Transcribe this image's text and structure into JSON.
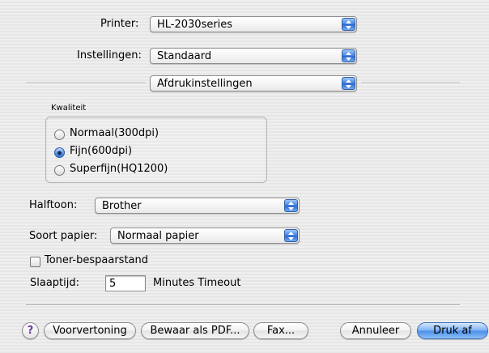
{
  "printer": {
    "label": "Printer:",
    "value": "HL-2030series"
  },
  "settings": {
    "label": "Instellingen:",
    "value": "Standaard"
  },
  "panel_popup": {
    "value": "Afdrukinstellingen"
  },
  "quality": {
    "title": "Kwaliteit",
    "options": [
      {
        "label": "Normaal(300dpi)",
        "selected": false
      },
      {
        "label": "Fijn(600dpi)",
        "selected": true
      },
      {
        "label": "Superfijn(HQ1200)",
        "selected": false
      }
    ]
  },
  "halftone": {
    "label": "Halftoon:",
    "value": "Brother"
  },
  "paper_type": {
    "label": "Soort papier:",
    "value": "Normaal papier"
  },
  "toner_save": {
    "label": "Toner-bespaarstand",
    "checked": false
  },
  "sleep": {
    "label": "Slaaptijd:",
    "value": "5",
    "unit": "Minutes Timeout"
  },
  "buttons": {
    "help": "?",
    "preview": "Voorvertoning",
    "save_pdf": "Bewaar als PDF...",
    "fax": "Fax...",
    "cancel": "Annuleer",
    "print": "Druk af"
  },
  "colors": {
    "accent": "#4b8ee8",
    "background": "#ececec"
  },
  "icons": {
    "popup_arrows": "up-down-arrows-icon",
    "radio": "radio-button",
    "checkbox": "checkbox"
  }
}
